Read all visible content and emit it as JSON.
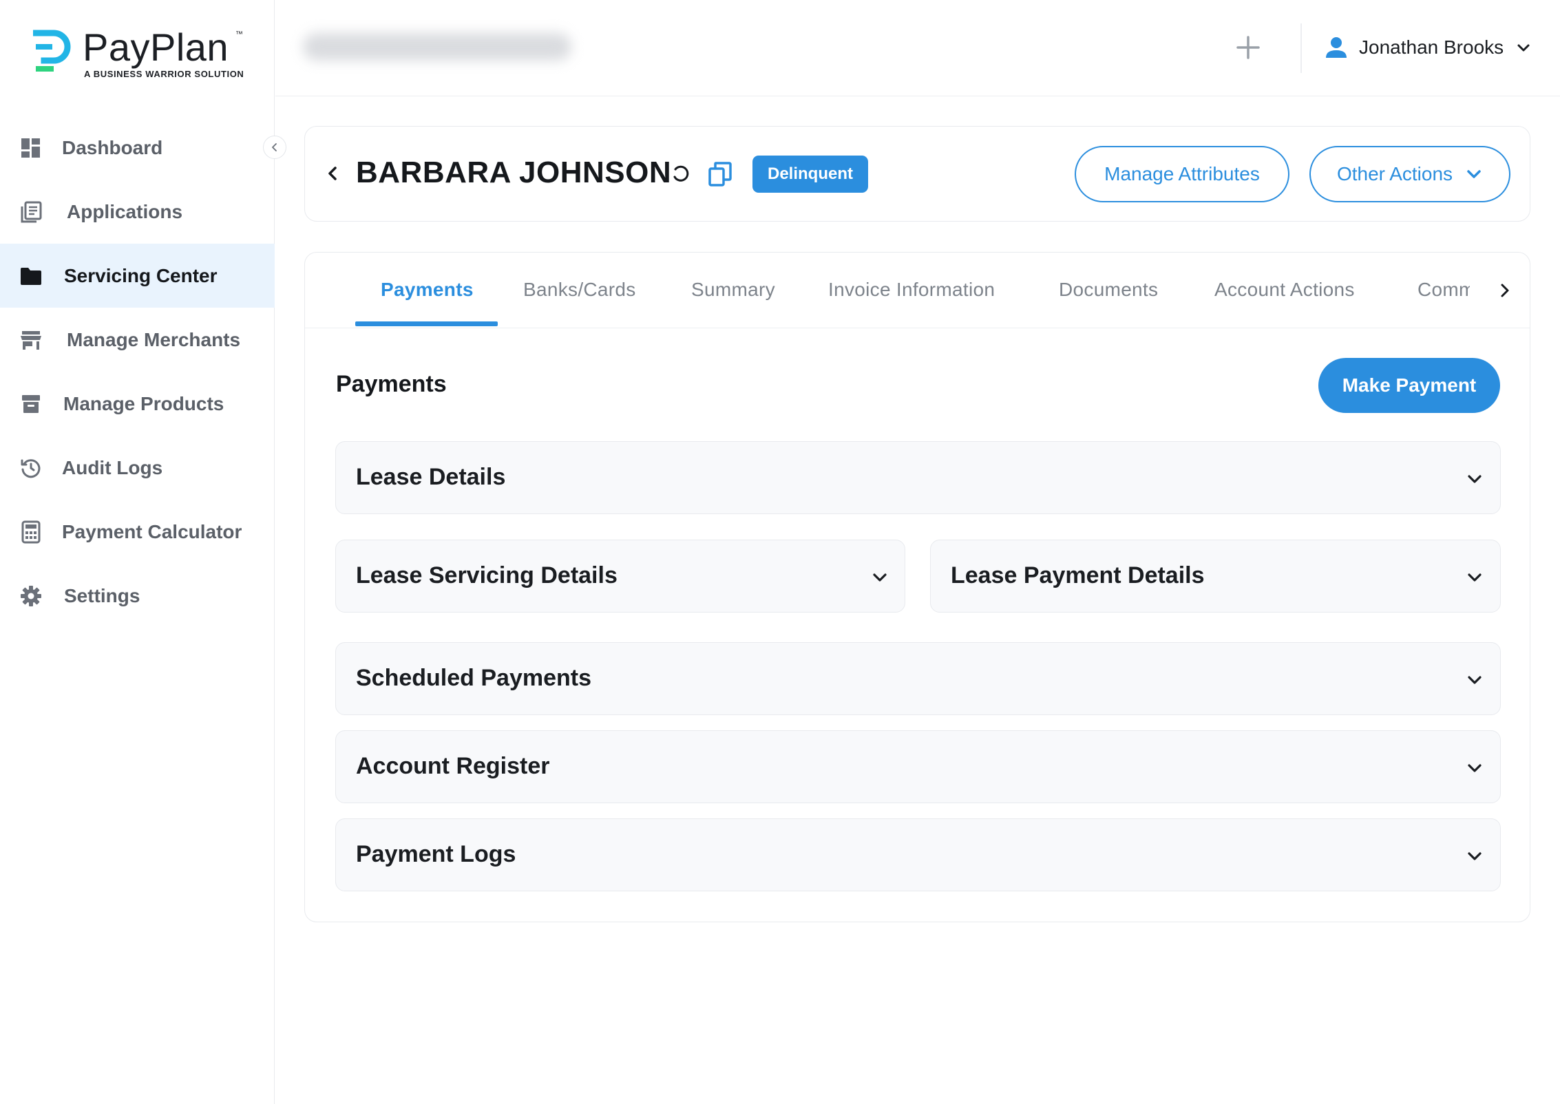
{
  "brand": {
    "name": "PayPlan",
    "trademark": "™",
    "tagline": "A BUSINESS WARRIOR SOLUTION",
    "colors": {
      "blue": "#2b8ede",
      "cyan": "#22b5e6",
      "green": "#2ed37f"
    }
  },
  "sidebar": {
    "items": [
      {
        "label": "Dashboard",
        "icon": "dashboard-icon",
        "active": false
      },
      {
        "label": "Applications",
        "icon": "applications-icon",
        "active": false
      },
      {
        "label": "Servicing Center",
        "icon": "folder-icon",
        "active": true
      },
      {
        "label": "Manage Merchants",
        "icon": "store-icon",
        "active": false
      },
      {
        "label": "Manage Products",
        "icon": "archive-box-icon",
        "active": false
      },
      {
        "label": "Audit Logs",
        "icon": "history-icon",
        "active": false
      },
      {
        "label": "Payment Calculator",
        "icon": "calculator-icon",
        "active": false
      },
      {
        "label": "Settings",
        "icon": "gear-icon",
        "active": false
      }
    ]
  },
  "topbar": {
    "user_name": "Jonathan Brooks"
  },
  "header": {
    "customer_name": "BARBARA JOHNSON",
    "status": "Delinquent",
    "manage_attributes_label": "Manage Attributes",
    "other_actions_label": "Other Actions"
  },
  "tabs": [
    {
      "label": "Payments",
      "active": true
    },
    {
      "label": "Banks/Cards",
      "active": false
    },
    {
      "label": "Summary",
      "active": false
    },
    {
      "label": "Invoice Information",
      "active": false
    },
    {
      "label": "Documents",
      "active": false
    },
    {
      "label": "Account Actions",
      "active": false
    },
    {
      "label": "Commu",
      "active": false
    }
  ],
  "payments": {
    "title": "Payments",
    "make_payment_label": "Make Payment",
    "sections": {
      "lease_details": "Lease Details",
      "lease_servicing_details": "Lease Servicing Details",
      "lease_payment_details": "Lease Payment Details",
      "scheduled_payments": "Scheduled Payments",
      "account_register": "Account Register",
      "payment_logs": "Payment Logs"
    }
  }
}
